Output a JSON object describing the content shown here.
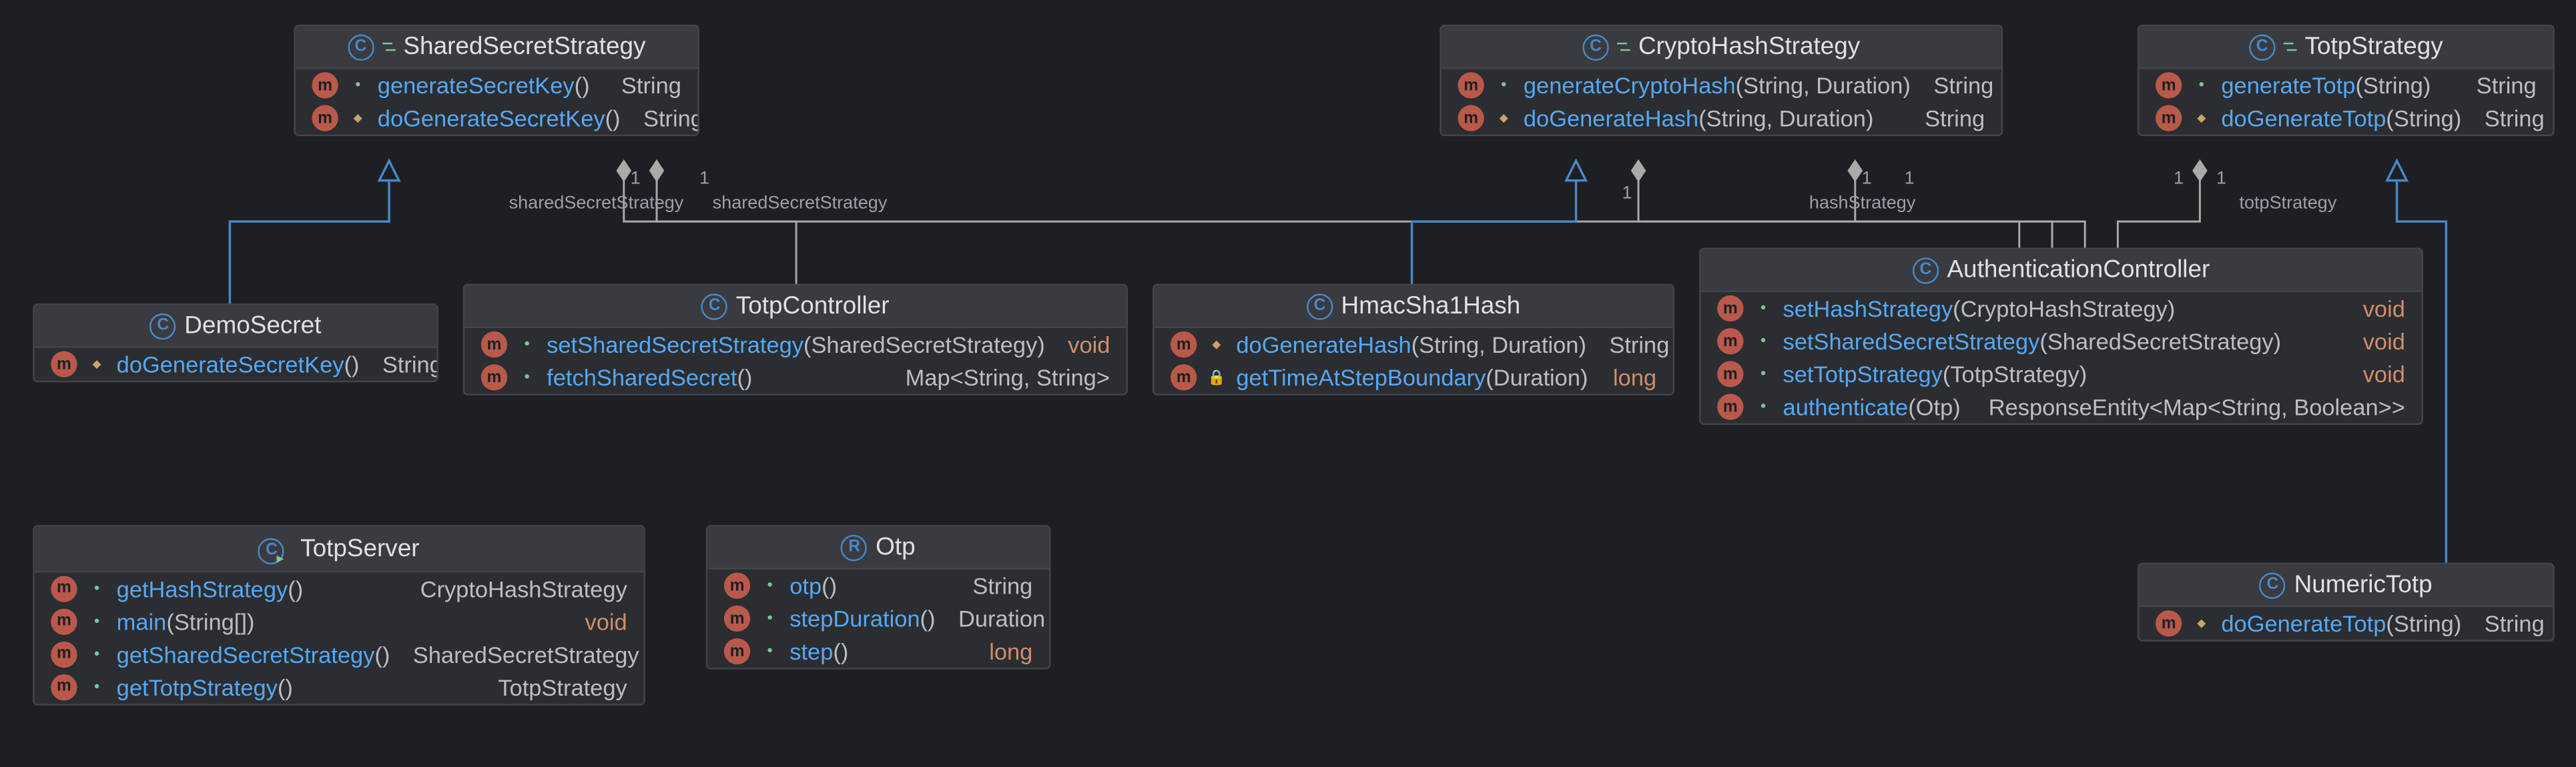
{
  "connectors": {
    "demoToShared": {
      "targetCardinality": "",
      "label": ""
    },
    "numericToTotp": {
      "targetCardinality": "",
      "label": ""
    },
    "hmacToCrypto": {
      "targetCardinality": "",
      "label": ""
    },
    "totpCtrlToShared": {
      "targetCardinality": "1",
      "label": "sharedSecretStrategy"
    },
    "authToShared": {
      "targetCardinality": "1",
      "label": "sharedSecretStrategy"
    },
    "authToCrypto1": {
      "targetCardinality": "1",
      "label": ""
    },
    "authToCrypto2": {
      "targetCardinality": "1",
      "label": "hashStrategy"
    },
    "authToCryptoExtra": {
      "targetCardinality": "1",
      "label": ""
    },
    "authToTotp": {
      "targetCardinality": "1",
      "label": "totpStrategy"
    },
    "authToTotpExtra": {
      "targetCardinality": "1",
      "label": ""
    }
  },
  "classes": {
    "sharedSecretStrategy": {
      "kind": "C",
      "abstract": true,
      "name": "SharedSecretStrategy",
      "members": [
        {
          "icon": "m",
          "vis": "pub",
          "name": "generateSecretKey",
          "params": "()",
          "ret": "String",
          "retStyle": "ref"
        },
        {
          "icon": "m",
          "vis": "prot",
          "name": "doGenerateSecretKey",
          "params": "()",
          "ret": "String",
          "retStyle": "ref"
        }
      ]
    },
    "cryptoHashStrategy": {
      "kind": "C",
      "abstract": true,
      "name": "CryptoHashStrategy",
      "members": [
        {
          "icon": "m",
          "vis": "pub",
          "name": "generateCryptoHash",
          "params": "(String, Duration)",
          "ret": "String",
          "retStyle": "ref"
        },
        {
          "icon": "m",
          "vis": "prot",
          "name": "doGenerateHash",
          "params": "(String, Duration)",
          "ret": "String",
          "retStyle": "ref"
        }
      ]
    },
    "totpStrategy": {
      "kind": "C",
      "abstract": true,
      "name": "TotpStrategy",
      "members": [
        {
          "icon": "m",
          "vis": "pub",
          "name": "generateTotp",
          "params": "(String)",
          "ret": "String",
          "retStyle": "ref"
        },
        {
          "icon": "m",
          "vis": "prot",
          "name": "doGenerateTotp",
          "params": "(String)",
          "ret": "String",
          "retStyle": "ref"
        }
      ]
    },
    "demoSecret": {
      "kind": "C",
      "abstract": false,
      "name": "DemoSecret",
      "members": [
        {
          "icon": "m",
          "vis": "prot",
          "name": "doGenerateSecretKey",
          "params": "()",
          "ret": "String",
          "retStyle": "ref"
        }
      ]
    },
    "totpController": {
      "kind": "C",
      "abstract": false,
      "name": "TotpController",
      "members": [
        {
          "icon": "m",
          "vis": "pub",
          "name": "setSharedSecretStrategy",
          "params": "(SharedSecretStrategy)",
          "ret": "void",
          "retStyle": "void"
        },
        {
          "icon": "m",
          "vis": "pub",
          "name": "fetchSharedSecret",
          "params": "()",
          "ret": "Map<String, String>",
          "retStyle": "ref"
        }
      ]
    },
    "hmacSha1Hash": {
      "kind": "C",
      "abstract": false,
      "name": "HmacSha1Hash",
      "members": [
        {
          "icon": "m",
          "vis": "prot",
          "name": "doGenerateHash",
          "params": "(String, Duration)",
          "ret": "String",
          "retStyle": "ref"
        },
        {
          "icon": "m",
          "vis": "priv",
          "name": "getTimeAtStepBoundary",
          "params": "(Duration)",
          "ret": "long",
          "retStyle": "prim"
        }
      ]
    },
    "authController": {
      "kind": "C",
      "abstract": false,
      "name": "AuthenticationController",
      "members": [
        {
          "icon": "m",
          "vis": "pub",
          "name": "setHashStrategy",
          "params": "(CryptoHashStrategy)",
          "ret": "void",
          "retStyle": "void"
        },
        {
          "icon": "m",
          "vis": "pub",
          "name": "setSharedSecretStrategy",
          "params": "(SharedSecretStrategy)",
          "ret": "void",
          "retStyle": "void"
        },
        {
          "icon": "m",
          "vis": "pub",
          "name": "setTotpStrategy",
          "params": "(TotpStrategy)",
          "ret": "void",
          "retStyle": "void"
        },
        {
          "icon": "m",
          "vis": "pub",
          "name": "authenticate",
          "params": "(Otp)",
          "ret": "ResponseEntity<Map<String, Boolean>>",
          "retStyle": "ref"
        }
      ]
    },
    "totpServer": {
      "kind": "C",
      "abstract": false,
      "runnable": true,
      "name": "TotpServer",
      "members": [
        {
          "icon": "m",
          "vis": "pub",
          "name": "getHashStrategy",
          "params": "()",
          "ret": "CryptoHashStrategy",
          "retStyle": "ref"
        },
        {
          "icon": "m",
          "vis": "pub",
          "name": "main",
          "params": "(String[])",
          "ret": "void",
          "retStyle": "void"
        },
        {
          "icon": "m",
          "vis": "pub",
          "name": "getSharedSecretStrategy",
          "params": "()",
          "ret": "SharedSecretStrategy",
          "retStyle": "ref"
        },
        {
          "icon": "m",
          "vis": "pub",
          "name": "getTotpStrategy",
          "params": "()",
          "ret": "TotpStrategy",
          "retStyle": "ref"
        }
      ]
    },
    "otp": {
      "kind": "R",
      "abstract": false,
      "name": "Otp",
      "members": [
        {
          "icon": "m",
          "vis": "pub",
          "name": "otp",
          "params": "()",
          "ret": "String",
          "retStyle": "ref"
        },
        {
          "icon": "m",
          "vis": "pub",
          "name": "stepDuration",
          "params": "()",
          "ret": "Duration",
          "retStyle": "ref"
        },
        {
          "icon": "m",
          "vis": "pub",
          "name": "step",
          "params": "()",
          "ret": "long",
          "retStyle": "prim"
        }
      ]
    },
    "numericTotp": {
      "kind": "C",
      "abstract": false,
      "name": "NumericTotp",
      "members": [
        {
          "icon": "m",
          "vis": "prot",
          "name": "doGenerateTotp",
          "params": "(String)",
          "ret": "String",
          "retStyle": "ref"
        }
      ]
    }
  }
}
